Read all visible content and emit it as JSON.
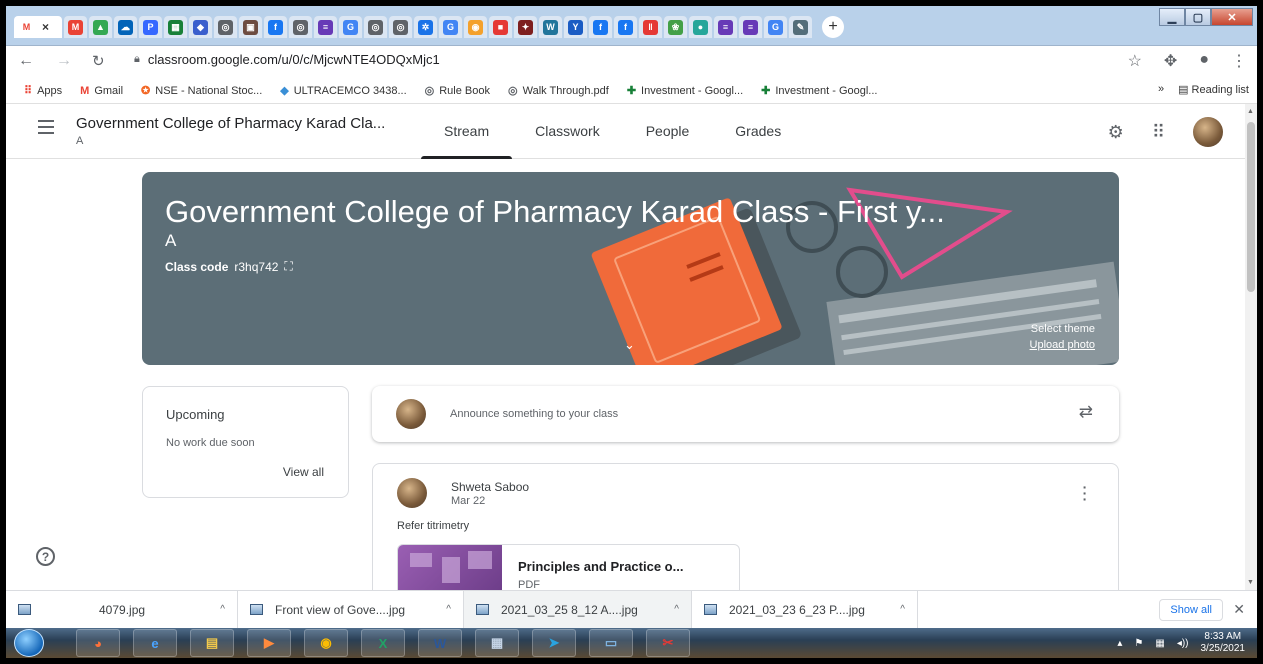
{
  "browser": {
    "tabs": [
      {
        "icon": "gmail-icon",
        "glyph": "M",
        "color": "#ea4335"
      },
      {
        "icon": "drive-icon",
        "glyph": "▲",
        "color": "#34a853"
      },
      {
        "icon": "onedrive-icon",
        "glyph": "☁",
        "color": "#0364b8"
      },
      {
        "icon": "pandora-icon",
        "glyph": "P",
        "color": "#3668ff"
      },
      {
        "icon": "sheets-icon",
        "glyph": "▦",
        "color": "#188038"
      },
      {
        "icon": "ultracemco-icon",
        "glyph": "◆",
        "color": "#3a5fcd"
      },
      {
        "icon": "globe-icon",
        "glyph": "◎",
        "color": "#5f6368"
      },
      {
        "icon": "photo-icon",
        "glyph": "▣",
        "color": "#6d4c41"
      },
      {
        "icon": "facebook-icon",
        "glyph": "f",
        "color": "#1877f2"
      },
      {
        "icon": "globe-icon",
        "glyph": "◎",
        "color": "#5f6368"
      },
      {
        "icon": "forms-icon",
        "glyph": "≡",
        "color": "#673ab7"
      },
      {
        "icon": "google-icon",
        "glyph": "G",
        "color": "#4285f4"
      },
      {
        "icon": "globe-icon",
        "glyph": "◎",
        "color": "#5f6368"
      },
      {
        "icon": "globe-icon",
        "glyph": "◎",
        "color": "#5f6368"
      },
      {
        "icon": "gear-icon",
        "glyph": "✲",
        "color": "#1a73e8"
      },
      {
        "icon": "google-icon",
        "glyph": "G",
        "color": "#4285f4"
      },
      {
        "icon": "chat-icon",
        "glyph": "◉",
        "color": "#f4a12c"
      },
      {
        "icon": "news-icon",
        "glyph": "■",
        "color": "#e53935"
      },
      {
        "icon": "star-icon",
        "glyph": "✦",
        "color": "#7e1f1f"
      },
      {
        "icon": "wordpress-icon",
        "glyph": "W",
        "color": "#21759b"
      },
      {
        "icon": "yahoo-icon",
        "glyph": "Y",
        "color": "#1a5cc4"
      },
      {
        "icon": "facebook-icon",
        "glyph": "f",
        "color": "#1877f2"
      },
      {
        "icon": "facebook-icon",
        "glyph": "f",
        "color": "#1877f2"
      },
      {
        "icon": "pause-icon",
        "glyph": "‖",
        "color": "#e53935"
      },
      {
        "icon": "leaf-icon",
        "glyph": "❀",
        "color": "#43a047"
      },
      {
        "icon": "circle-icon",
        "glyph": "●",
        "color": "#26a69a"
      },
      {
        "icon": "forms-icon",
        "glyph": "≡",
        "color": "#673ab7"
      },
      {
        "icon": "forms-icon",
        "glyph": "≡",
        "color": "#673ab7"
      },
      {
        "icon": "google-icon",
        "glyph": "G",
        "color": "#4285f4"
      },
      {
        "icon": "feather-icon",
        "glyph": "✎",
        "color": "#546e7a"
      }
    ],
    "active_tab": {
      "glyph": "M",
      "color": "#ea4335",
      "close": "×"
    },
    "new_tab": "+",
    "url": "classroom.google.com/u/0/c/MjcwNTE4ODQxMjc1",
    "bookmarks": [
      {
        "label": "Apps",
        "glyph": "⠿",
        "color": "#ea4335"
      },
      {
        "label": "Gmail",
        "glyph": "M",
        "color": "#ea4335"
      },
      {
        "label": "NSE - National Stoc...",
        "glyph": "✪",
        "color": "#f26522"
      },
      {
        "label": "ULTRACEMCO 3438...",
        "glyph": "◆",
        "color": "#3a8fd6"
      },
      {
        "label": "Rule Book",
        "glyph": "◎",
        "color": "#5f6368"
      },
      {
        "label": "Walk Through.pdf",
        "glyph": "◎",
        "color": "#5f6368"
      },
      {
        "label": "Investment - Googl...",
        "glyph": "✚",
        "color": "#188038"
      },
      {
        "label": "Investment - Googl...",
        "glyph": "✚",
        "color": "#188038"
      }
    ],
    "reading_list": "Reading list",
    "chevrons": "»"
  },
  "classroom": {
    "class_title": "Government College of Pharmacy Karad Cla...",
    "class_section": "A",
    "tabs": [
      "Stream",
      "Classwork",
      "People",
      "Grades"
    ],
    "active_tab": "Stream",
    "banner": {
      "title": "Government College of Pharmacy Karad Class - First y...",
      "section": "A",
      "class_code_label": "Class code",
      "class_code": "r3hq742",
      "select_theme": "Select theme",
      "upload_photo": "Upload photo",
      "color": "#5c6e77"
    },
    "upcoming": {
      "title": "Upcoming",
      "status": "No work due soon",
      "view_all": "View all"
    },
    "announce_placeholder": "Announce something to your class",
    "post": {
      "author": "Shweta Saboo",
      "date": "Mar 22",
      "body": "Refer titrimetry",
      "attachment_name": "Principles and Practice o...",
      "attachment_type": "PDF"
    }
  },
  "downloads": [
    {
      "name": "4079.jpg",
      "selected": false
    },
    {
      "name": "Front view of Gove....jpg",
      "selected": false
    },
    {
      "name": "2021_03_25 8_12 A....jpg",
      "selected": true
    },
    {
      "name": "2021_03_23 6_23 P....jpg",
      "selected": false
    }
  ],
  "show_all": "Show all",
  "taskbar": {
    "apps": [
      {
        "icon": "firefox-icon",
        "glyph": "◕",
        "color": "#ff7139"
      },
      {
        "icon": "internet-explorer-icon",
        "glyph": "e",
        "color": "#4aa3ff"
      },
      {
        "icon": "folder-icon",
        "glyph": "▤",
        "color": "#f2c94c"
      },
      {
        "icon": "media-player-icon",
        "glyph": "▶",
        "color": "#ff8a3d"
      },
      {
        "icon": "chrome-icon",
        "glyph": "◉",
        "color": "#fbbc04"
      },
      {
        "icon": "excel-icon",
        "glyph": "X",
        "color": "#21a366"
      },
      {
        "icon": "word-icon",
        "glyph": "W",
        "color": "#2b579a"
      },
      {
        "icon": "calculator-icon",
        "glyph": "▦",
        "color": "#c5d4e6"
      },
      {
        "icon": "telegram-icon",
        "glyph": "➤",
        "color": "#2aa3df"
      },
      {
        "icon": "display-icon",
        "glyph": "▭",
        "color": "#7fb3e0"
      },
      {
        "icon": "snipping-icon",
        "glyph": "✂",
        "color": "#e53935"
      }
    ],
    "time": "8:33 AM",
    "date": "3/25/2021"
  }
}
